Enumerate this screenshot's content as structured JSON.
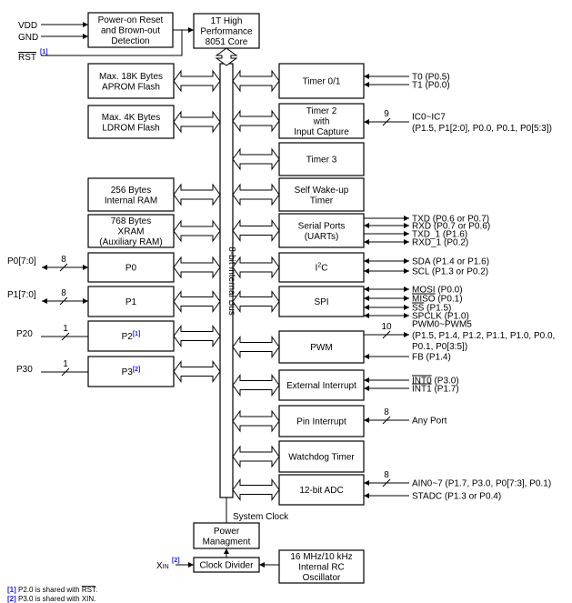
{
  "left_inputs": {
    "vdd": "VDD",
    "gnd": "GND",
    "rst": "RST",
    "rst_note": "[1]"
  },
  "blocks": {
    "por": [
      "Power-on Reset",
      "and Brown-out",
      "Detection"
    ],
    "core": [
      "1T High",
      "Performance",
      "8051 Core"
    ],
    "aprom": [
      "Max. 18K Bytes",
      "APROM Flash"
    ],
    "ldrom": [
      "Max. 4K Bytes",
      "LDROM Flash"
    ],
    "ram": [
      "256 Bytes",
      "Internal RAM"
    ],
    "xram": [
      "768 Bytes",
      "XRAM",
      "(Auxiliary RAM)"
    ],
    "p0": [
      "P0"
    ],
    "p1": [
      "P1"
    ],
    "p2": [
      "P2"
    ],
    "p3": [
      "P3"
    ],
    "timer01": [
      "Timer 0/1"
    ],
    "timer2": [
      "Timer 2",
      "with",
      "Input Capture"
    ],
    "timer3": [
      "Timer 3"
    ],
    "wakeup": [
      "Self Wake-up",
      "Timer"
    ],
    "uart": [
      "Serial Ports",
      "(UARTs)"
    ],
    "i2c": [
      "I2C"
    ],
    "spi": [
      "SPI"
    ],
    "pwm": [
      "PWM"
    ],
    "extint": [
      "External Interrupt"
    ],
    "pinint": [
      "Pin Interrupt"
    ],
    "wdt": [
      "Watchdog Timer"
    ],
    "adc": [
      "12-bit ADC"
    ],
    "pmu": [
      "Power",
      "Managment"
    ],
    "clkdiv": [
      "Clock Divider"
    ],
    "rcosc": [
      "16 MHz/10 kHz",
      "Internal RC",
      "Oscillator"
    ]
  },
  "superscripts": {
    "i2c": "2",
    "p2": "[1]",
    "p3": "[2]"
  },
  "bus_label": "8-bit Internal Bus",
  "system_clock": "System Clock",
  "xin": {
    "label": "XIN",
    "note": "[2]"
  },
  "ports": {
    "p0": {
      "label": "P0[7:0]",
      "width": "8"
    },
    "p1": {
      "label": "P1[7:0]",
      "width": "8"
    },
    "p2": {
      "label": "P20",
      "width": "1"
    },
    "p3": {
      "label": "P30",
      "width": "1"
    }
  },
  "signals": {
    "t0": {
      "text": "T0 (P0.5)"
    },
    "t1": {
      "text": "T1 (P0.0)"
    },
    "ic": {
      "text": "IC0~IC7",
      "text2": "(P1.5, P1[2:0], P0.0, P0.1, P0[5:3])",
      "width": "9"
    },
    "txd": {
      "text": "TXD (P0.6 or P0.7)"
    },
    "rxd": {
      "text": "RXD (P0.7 or P0.6)"
    },
    "txd1": {
      "text": "TXD_1 (P1.6)"
    },
    "rxd1": {
      "text": "RXD_1 (P0.2)"
    },
    "sda": {
      "text": "SDA (P1.4 or P1.6)"
    },
    "scl": {
      "text": "SCL (P1.3 or P0.2)"
    },
    "mosi": {
      "text": "MOSI (P0.0)"
    },
    "miso": {
      "over": "MISO",
      "text": " (P0.1)"
    },
    "ss": {
      "over": "SS",
      "text": " (P1.5)"
    },
    "spclk": {
      "text": "SPCLK (P1.0)"
    },
    "pwm": {
      "text": "PWM0~PWM5",
      "text2": "(P1.5, P1.4, P1.2, P1.1, P1.0, P0.0,",
      "text3": "P0.1, P0[3:5])",
      "width": "10"
    },
    "fb": {
      "text": "FB (P1.4)"
    },
    "int0": {
      "over": "INT0",
      "text": " (P3.0)"
    },
    "int1": {
      "over": "INT1",
      "text": " (P1.7)"
    },
    "anyport": {
      "text": "Any Port",
      "width": "8"
    },
    "ain": {
      "text": "AIN0~7 (P1.7, P3.0, P0[7:3],  P0.1)",
      "width": "8"
    },
    "stadc": {
      "text": "STADC (P1.3 or P0.4)"
    }
  },
  "footnotes": [
    {
      "num": "[1]",
      "text": "P2.0 is shared with ",
      "over": "RST",
      "end": "."
    },
    {
      "num": "[2]",
      "text": "P3.0 is shared with XIN."
    }
  ],
  "colors": {
    "note": "#1a1aff",
    "line": "#000000"
  }
}
